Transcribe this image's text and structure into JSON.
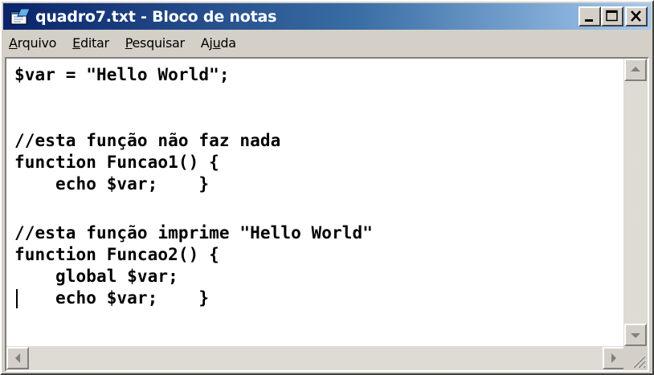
{
  "window": {
    "title": "quadro7.txt - Bloco de notas",
    "app_icon": "notepad-icon",
    "controls": [
      "minimize-icon",
      "maximize-icon",
      "close-icon"
    ]
  },
  "menu": {
    "items": [
      {
        "pre": "",
        "key": "A",
        "post": "rquivo"
      },
      {
        "pre": "",
        "key": "E",
        "post": "ditar"
      },
      {
        "pre": "",
        "key": "P",
        "post": "esquisar"
      },
      {
        "pre": "Aj",
        "key": "u",
        "post": "da"
      }
    ]
  },
  "editor": {
    "lines": [
      "$var = \"Hello World\";",
      "",
      "//esta função não faz nada",
      "function Funcao1() {",
      "    echo $var;    }",
      "",
      "//esta função imprime \"Hello World\"",
      "function Funcao2() {",
      "    global $var;",
      "    echo $var;    }"
    ]
  },
  "colors": {
    "titlebar_start": "#0a246a",
    "titlebar_end": "#a6caf0",
    "chrome": "#d4d0c8",
    "text": "#000000"
  }
}
